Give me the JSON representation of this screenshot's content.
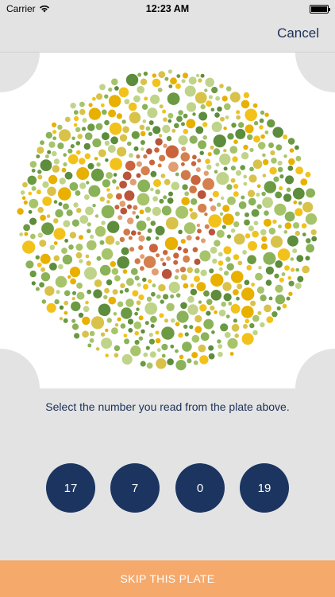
{
  "status_bar": {
    "carrier": "Carrier",
    "time": "12:23 AM",
    "battery_level": 1.0,
    "wifi_icon": "wifi-icon",
    "battery_icon": "battery-icon"
  },
  "nav": {
    "cancel_label": "Cancel"
  },
  "plate": {
    "image": "ishihara-color-plate",
    "colors": {
      "background_dots": [
        "#6b9a43",
        "#8ab259",
        "#a7c46b",
        "#bfd48a",
        "#5c8c3c",
        "#f2c21b",
        "#e8b000",
        "#d9c24a"
      ],
      "figure_dots": [
        "#c9643c",
        "#d5804f",
        "#e09e72",
        "#b8553a",
        "#cf7a48"
      ]
    }
  },
  "instruction": "Select the number you read from the plate above.",
  "answers": [
    {
      "label": "17"
    },
    {
      "label": "7"
    },
    {
      "label": "0"
    },
    {
      "label": "19"
    }
  ],
  "skip_label": "SKIP THIS PLATE",
  "colors": {
    "accent": "#1c3460",
    "skip": "#f5a96a",
    "background": "#e3e3e3"
  }
}
